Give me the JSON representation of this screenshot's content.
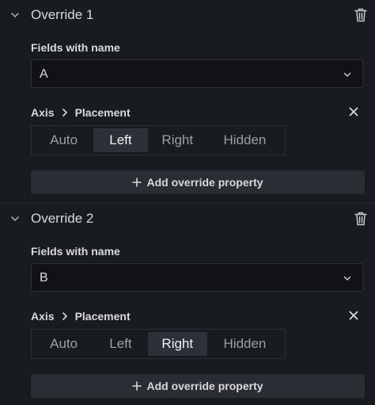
{
  "overrides": [
    {
      "title": "Override 1",
      "field_label": "Fields with name",
      "field_value": "A",
      "property_parent": "Axis",
      "property_name": "Placement",
      "options": [
        "Auto",
        "Left",
        "Right",
        "Hidden"
      ],
      "selected": "Left",
      "add_label": "Add override property"
    },
    {
      "title": "Override 2",
      "field_label": "Fields with name",
      "field_value": "B",
      "property_parent": "Axis",
      "property_name": "Placement",
      "options": [
        "Auto",
        "Left",
        "Right",
        "Hidden"
      ],
      "selected": "Right",
      "add_label": "Add override property"
    }
  ],
  "icons": {
    "collapse": "chevron-down-icon",
    "delete": "trash-icon",
    "select": "caret-down-icon",
    "breadcrumb": "chevron-right-icon",
    "remove": "close-icon",
    "add": "plus-icon"
  }
}
